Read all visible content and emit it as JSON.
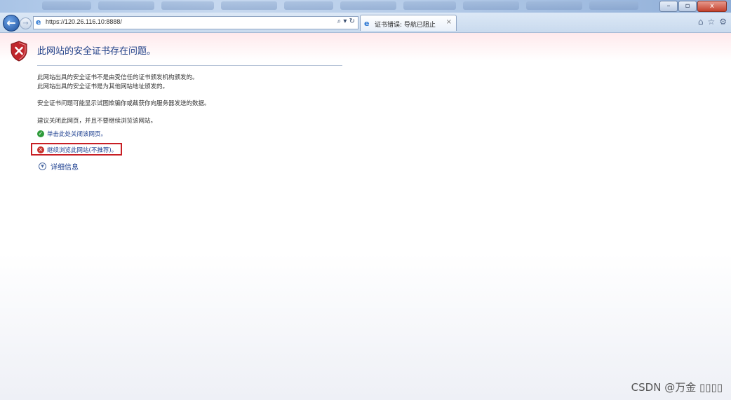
{
  "browser": {
    "address_url": "https://120.26.116.10:8888/",
    "tab_title": "证书错误: 导航已阻止",
    "tab_close": "×",
    "window_buttons": [
      "–",
      "▫",
      "x"
    ]
  },
  "error_page": {
    "title": "此网站的安全证书存在问题。",
    "paragraph1_line1": "此网站出具的安全证书不是由受信任的证书颁发机构颁发的。",
    "paragraph1_line2": "此网站出具的安全证书是为其他网站地址颁发的。",
    "paragraph2": "安全证书问题可能显示试图欺骗你或截获你向服务器发送的数据。",
    "paragraph3": "建议关闭此网页，并且不要继续浏览该网站。",
    "close_link": "单击此处关闭该网页。",
    "continue_link": "继续浏览此网站(不推荐)。",
    "details_link": "详细信息"
  },
  "watermark": "CSDN @万金    ▯▯▯▯",
  "icons": {
    "back": "back-arrow-icon",
    "forward": "forward-arrow-icon",
    "shield": "shield-x-icon",
    "ok": "green-shield-check-icon",
    "bad": "red-shield-x-icon",
    "expand": "expand-circle-icon"
  },
  "colors": {
    "link": "#1a3d8f",
    "title": "#1f3f87",
    "highlight": "#c81f25"
  }
}
